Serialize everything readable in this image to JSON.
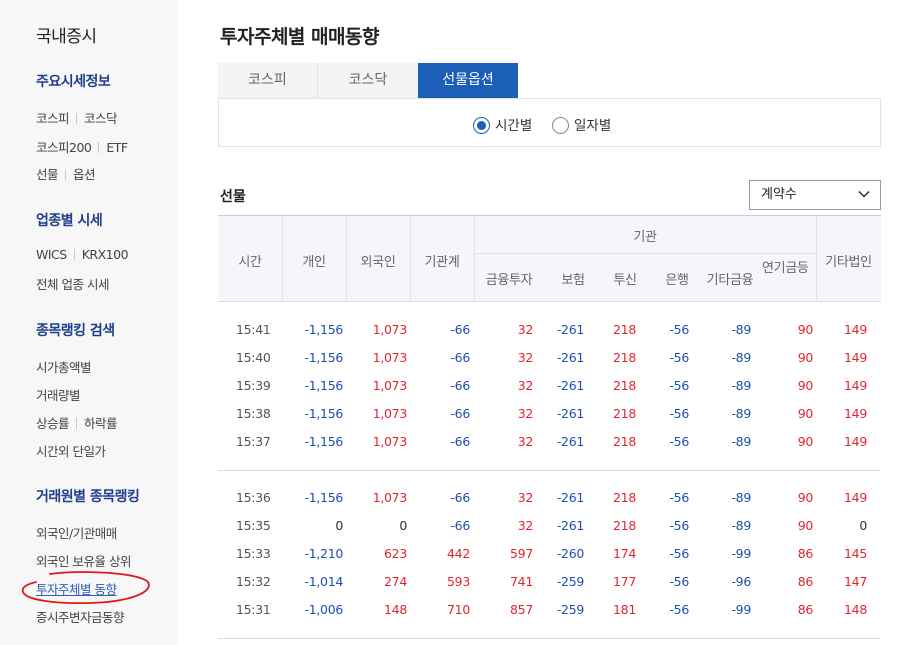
{
  "sidebar": {
    "title": "국내증시",
    "sections": [
      {
        "title": "주요시세정보",
        "lines": [
          [
            "코스피",
            "코스닥"
          ],
          [
            "코스피200",
            "ETF"
          ],
          [
            "선물",
            "옵션"
          ]
        ]
      },
      {
        "title": "업종별 시세",
        "lines": [
          [
            "WICS",
            "KRX100"
          ],
          [
            "전체 업종 시세"
          ]
        ]
      },
      {
        "title": "종목랭킹 검색",
        "lines": [
          [
            "시가총액별"
          ],
          [
            "거래량별"
          ],
          [
            "상승률",
            "하락률"
          ],
          [
            "시간외 단일가"
          ]
        ]
      },
      {
        "title": "거래원별 종목랭킹",
        "lines": [
          [
            "외국인/기관매매"
          ],
          [
            "외국인 보유율 상위"
          ],
          [
            "투자주체별 동향"
          ],
          [
            "증시주변자금동향"
          ]
        ]
      }
    ]
  },
  "page": {
    "title": "투자주체별 매매동향"
  },
  "tabs": [
    "코스피",
    "코스닥",
    "선물옵션"
  ],
  "active_tab": 2,
  "radios": [
    {
      "label": "시간별",
      "checked": true
    },
    {
      "label": "일자별",
      "checked": false
    }
  ],
  "section_label": "선물",
  "select": {
    "value": "계약수"
  },
  "columns": {
    "time": "시간",
    "individual": "개인",
    "foreign": "외국인",
    "inst_total": "기관계",
    "inst_group": "기관",
    "inst_sub": [
      "금융투자",
      "보험",
      "투신",
      "은행",
      "기타금융",
      "연기금등"
    ],
    "other_corp": "기타법인"
  },
  "groups": [
    [
      [
        "15:41",
        "-1,156",
        "1,073",
        "-66",
        "32",
        "-261",
        "218",
        "-56",
        "-89",
        "90",
        "149"
      ],
      [
        "15:40",
        "-1,156",
        "1,073",
        "-66",
        "32",
        "-261",
        "218",
        "-56",
        "-89",
        "90",
        "149"
      ],
      [
        "15:39",
        "-1,156",
        "1,073",
        "-66",
        "32",
        "-261",
        "218",
        "-56",
        "-89",
        "90",
        "149"
      ],
      [
        "15:38",
        "-1,156",
        "1,073",
        "-66",
        "32",
        "-261",
        "218",
        "-56",
        "-89",
        "90",
        "149"
      ],
      [
        "15:37",
        "-1,156",
        "1,073",
        "-66",
        "32",
        "-261",
        "218",
        "-56",
        "-89",
        "90",
        "149"
      ]
    ],
    [
      [
        "15:36",
        "-1,156",
        "1,073",
        "-66",
        "32",
        "-261",
        "218",
        "-56",
        "-89",
        "90",
        "149"
      ],
      [
        "15:35",
        "0",
        "0",
        "-66",
        "32",
        "-261",
        "218",
        "-56",
        "-89",
        "90",
        "0"
      ],
      [
        "15:33",
        "-1,210",
        "623",
        "442",
        "597",
        "-260",
        "174",
        "-56",
        "-99",
        "86",
        "145"
      ],
      [
        "15:32",
        "-1,014",
        "274",
        "593",
        "741",
        "-259",
        "177",
        "-56",
        "-96",
        "86",
        "147"
      ],
      [
        "15:31",
        "-1,006",
        "148",
        "710",
        "857",
        "-259",
        "181",
        "-56",
        "-99",
        "86",
        "148"
      ]
    ]
  ]
}
